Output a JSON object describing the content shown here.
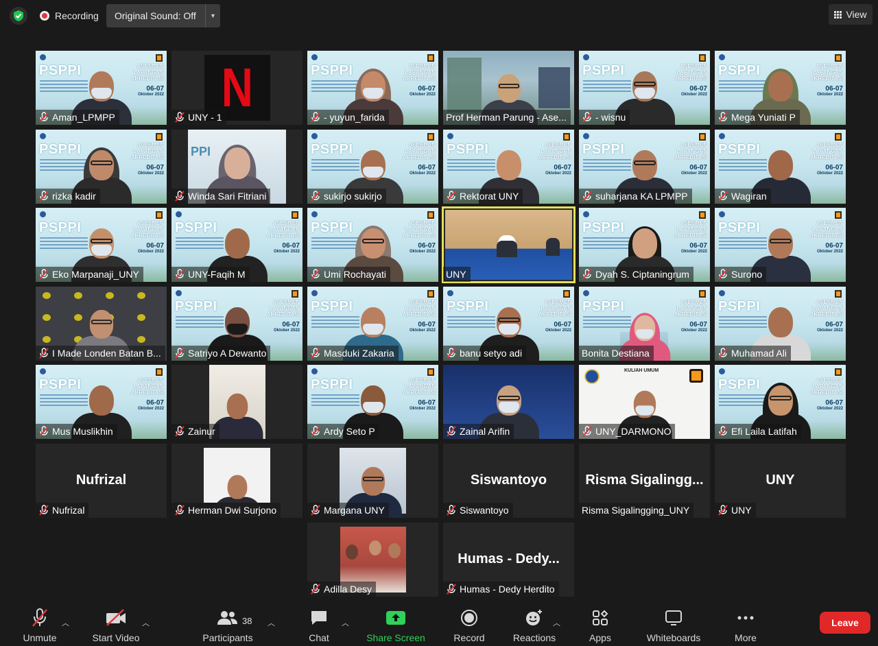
{
  "topbar": {
    "recording_label": "Recording",
    "original_sound_label": "Original Sound: Off",
    "view_label": "View"
  },
  "tiles": [
    {
      "name": "Aman_LPMPP",
      "type": "psppi",
      "muted": true,
      "active": false,
      "skin": "#b07a5a",
      "clothes": "#2b2f3a",
      "mask": true,
      "glasses": false
    },
    {
      "name": "UNY - 1",
      "type": "netflix",
      "muted": true,
      "active": false
    },
    {
      "name": "- yuyun_farida",
      "type": "psppi",
      "muted": true,
      "active": false,
      "skin": "#c48a6a",
      "clothes": "#4a3a3a",
      "mask": true,
      "hijab": "#8a6b5a"
    },
    {
      "name": "Prof Herman Parung - Ase...",
      "type": "building",
      "muted": false,
      "active": false,
      "skin": "#c9a27a",
      "clothes": "#3a3f4a",
      "glasses": true
    },
    {
      "name": "- wisnu",
      "type": "psppi",
      "muted": true,
      "active": false,
      "skin": "#a8785a",
      "clothes": "#2a2a2a",
      "mask": true,
      "glasses": true
    },
    {
      "name": "Mega Yuniati P",
      "type": "psppi",
      "muted": true,
      "active": false,
      "skin": "#a87050",
      "clothes": "#6a6a50",
      "hijab": "#6a7a50"
    },
    {
      "name": "rizka kadir",
      "type": "psppi",
      "muted": true,
      "active": false,
      "skin": "#c08a6a",
      "clothes": "#2b2b2b",
      "glasses": true,
      "hijab": "#3a3a3a"
    },
    {
      "name": "Winda Sari Fitriani",
      "type": "photo-hijab",
      "muted": true,
      "active": false,
      "skin": "#d8b09a",
      "clothes": "#5a5560",
      "hijab": "#6a6470"
    },
    {
      "name": "sukirjo sukirjo",
      "type": "psppi",
      "muted": true,
      "active": false,
      "skin": "#a87050",
      "clothes": "#3a3a3a",
      "mask": true
    },
    {
      "name": "Rektorat UNY",
      "type": "psppi",
      "muted": true,
      "active": false,
      "skin": "#c8906a",
      "clothes": "#2f2f35"
    },
    {
      "name": "suharjana KA LPMPP",
      "type": "psppi",
      "muted": true,
      "active": false,
      "skin": "#b07a5a",
      "clothes": "#2b2e38",
      "glasses": true
    },
    {
      "name": "Wagiran",
      "type": "psppi",
      "muted": true,
      "active": false,
      "skin": "#a06848",
      "clothes": "#262a36"
    },
    {
      "name": "Eko Marpanaji_UNY",
      "type": "psppi",
      "muted": true,
      "active": false,
      "skin": "#c4906c",
      "clothes": "#2f2f2f",
      "glasses": true,
      "mask": true
    },
    {
      "name": "UNY-Faqih M",
      "type": "psppi",
      "muted": true,
      "active": false,
      "skin": "#a06a4a",
      "clothes": "#222"
    },
    {
      "name": "Umi Rochayati",
      "type": "psppi",
      "muted": true,
      "active": false,
      "skin": "#c89070",
      "clothes": "#5a4a40",
      "glasses": true,
      "hijab": "#8a7a70"
    },
    {
      "name": "UNY",
      "type": "stage",
      "muted": false,
      "active": true
    },
    {
      "name": "Dyah S. Ciptaningrum",
      "type": "psppi",
      "muted": true,
      "active": false,
      "skin": "#d0a080",
      "clothes": "#2a2a2a",
      "hair": "#1a1a1a"
    },
    {
      "name": "Surono",
      "type": "psppi",
      "muted": true,
      "active": false,
      "skin": "#b07858",
      "clothes": "#2a3040",
      "glasses": true
    },
    {
      "name": "I Made Londen Batan B...",
      "type": "logos",
      "muted": true,
      "active": false,
      "skin": "#c09070",
      "clothes": "#7a7a80",
      "glasses": true
    },
    {
      "name": "Satriyo A Dewanto",
      "type": "psppi",
      "muted": true,
      "active": false,
      "skin": "#7a5040",
      "clothes": "#1a1a1a",
      "mask": true,
      "maskColor": "#1a1a1a"
    },
    {
      "name": "Masduki Zakaria",
      "type": "psppi",
      "muted": true,
      "active": false,
      "skin": "#b88060",
      "clothes": "#2f6a8a",
      "mask": true
    },
    {
      "name": "banu setyo adi",
      "type": "psppi",
      "muted": true,
      "active": false,
      "skin": "#a87050",
      "clothes": "#1e1e1e",
      "mask": true,
      "glasses": true
    },
    {
      "name": "Bonita Destiana",
      "type": "psppi-building",
      "muted": false,
      "active": false,
      "skin": "#e0b8a0",
      "clothes": "#e05a80",
      "mask": true,
      "hijab": "#e05a80"
    },
    {
      "name": "Muhamad Ali",
      "type": "psppi",
      "muted": true,
      "active": false,
      "skin": "#a87050",
      "clothes": "#d8d8d8"
    },
    {
      "name": "Mus Muslikhin",
      "type": "psppi",
      "muted": true,
      "active": false,
      "skin": "#a06a4a",
      "clothes": "#202020"
    },
    {
      "name": "Zainur",
      "type": "photo-suit",
      "muted": true,
      "active": false,
      "skin": "#a87050",
      "clothes": "#2a2a3a"
    },
    {
      "name": "Ardy Seto P",
      "type": "psppi",
      "muted": true,
      "active": false,
      "skin": "#8a5a3a",
      "clothes": "#1a1a1a",
      "mask": true
    },
    {
      "name": "Zainal Arifin",
      "type": "slide",
      "muted": true,
      "active": false,
      "skin": "#c8a080",
      "clothes": "#2a2f3a",
      "mask": true,
      "glasses": true
    },
    {
      "name": "UNY_DARMONO",
      "type": "kuliah",
      "muted": true,
      "active": false,
      "skin": "#b07a5a",
      "clothes": "#222",
      "mask": true,
      "kuliah_title": "KULIAH UMUM"
    },
    {
      "name": "Efi Laila Latifah",
      "type": "psppi",
      "muted": true,
      "active": false,
      "skin": "#c8946c",
      "clothes": "#1a1a1a",
      "glasses": true,
      "hijab": "#1a1a1a"
    },
    {
      "name": "Nufrizal",
      "type": "text",
      "muted": true,
      "active": false,
      "bigname": "Nufrizal"
    },
    {
      "name": "Herman Dwi Surjono",
      "type": "photo-suit-white",
      "muted": true,
      "active": false,
      "skin": "#b07a5a",
      "clothes": "#2a2a30"
    },
    {
      "name": "Margana UNY",
      "type": "photo-blue",
      "muted": true,
      "active": false,
      "skin": "#b07a5a",
      "clothes": "#1f2a40",
      "glasses": true
    },
    {
      "name": "Siswantoyo",
      "type": "text",
      "muted": true,
      "active": false,
      "bigname": "Siswantoyo"
    },
    {
      "name": "Risma Sigalingging_UNY",
      "type": "text",
      "muted": false,
      "active": false,
      "bigname": "Risma  Sigalingg..."
    },
    {
      "name": "UNY",
      "type": "text",
      "muted": true,
      "active": false,
      "bigname": "UNY"
    },
    {
      "name": "Adilla Desy",
      "type": "photo-group",
      "muted": true,
      "active": false
    },
    {
      "name": "Humas - Dedy Herdito",
      "type": "text",
      "muted": true,
      "active": false,
      "bigname": "Humas  -  Dedy..."
    }
  ],
  "toolbar": {
    "unmute": "Unmute",
    "start_video": "Start Video",
    "participants": "Participants",
    "participants_count": "38",
    "chat": "Chat",
    "share_screen": "Share Screen",
    "record": "Record",
    "reactions": "Reactions",
    "apps": "Apps",
    "whiteboards": "Whiteboards",
    "more": "More",
    "leave": "Leave"
  },
  "banner": {
    "title": "PSPPI",
    "right_line1": "ASESMEN",
    "right_line2": "LAPANGAN",
    "right_line3": "AKREDITASI",
    "date": "06-07",
    "month": "Oktober 2022"
  },
  "colors": {
    "active_outline": "#e2e05a",
    "share_green": "#2fd15a",
    "leave_red": "#e02828",
    "muted_red": "#e0393e"
  }
}
